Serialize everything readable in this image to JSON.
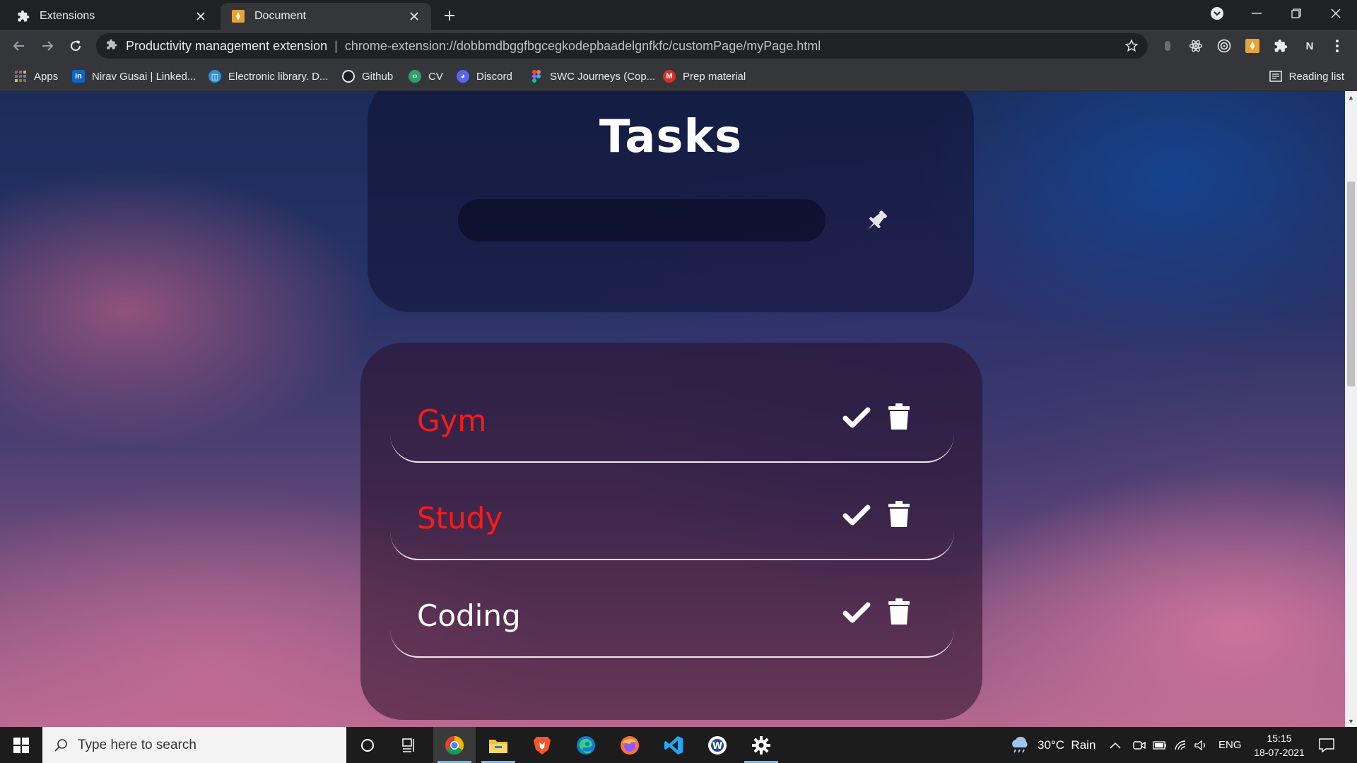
{
  "browser": {
    "tabs": [
      {
        "title": "Extensions",
        "icon": "puzzle-icon",
        "active": false
      },
      {
        "title": "Document",
        "icon": "extension-favicon-icon",
        "active": true
      }
    ],
    "omnibox": {
      "site_name": "Productivity management extension",
      "separator": "|",
      "url": "chrome-extension://dobbmdbggfbgcegkodepbaadelgnfkfc/customPage/myPage.html"
    },
    "profile_initial": "N",
    "bookmarks": [
      {
        "label": "Apps",
        "icon": "apps-grid-icon"
      },
      {
        "label": "Nirav Gusai | Linked...",
        "icon": "linkedin-icon"
      },
      {
        "label": "Electronic library. D...",
        "icon": "library-icon"
      },
      {
        "label": "Github",
        "icon": "github-icon"
      },
      {
        "label": "CV",
        "icon": "cv-icon"
      },
      {
        "label": "Discord",
        "icon": "discord-icon"
      },
      {
        "label": "SWC Journeys (Cop...",
        "icon": "figma-icon"
      },
      {
        "label": "Prep material",
        "icon": "gmail-icon"
      }
    ],
    "reading_list": "Reading list"
  },
  "app": {
    "title": "Tasks",
    "input": {
      "value": "",
      "placeholder": ""
    },
    "tasks": [
      {
        "label": "Gym",
        "color": "#ff1a1a"
      },
      {
        "label": "Study",
        "color": "#ff1a1a"
      },
      {
        "label": "Coding",
        "color": "#ffffff"
      }
    ]
  },
  "taskbar": {
    "search_placeholder": "Type here to search",
    "weather": "30°C  Rain",
    "language": "ENG",
    "time": "15:15",
    "date": "18-07-2021"
  }
}
